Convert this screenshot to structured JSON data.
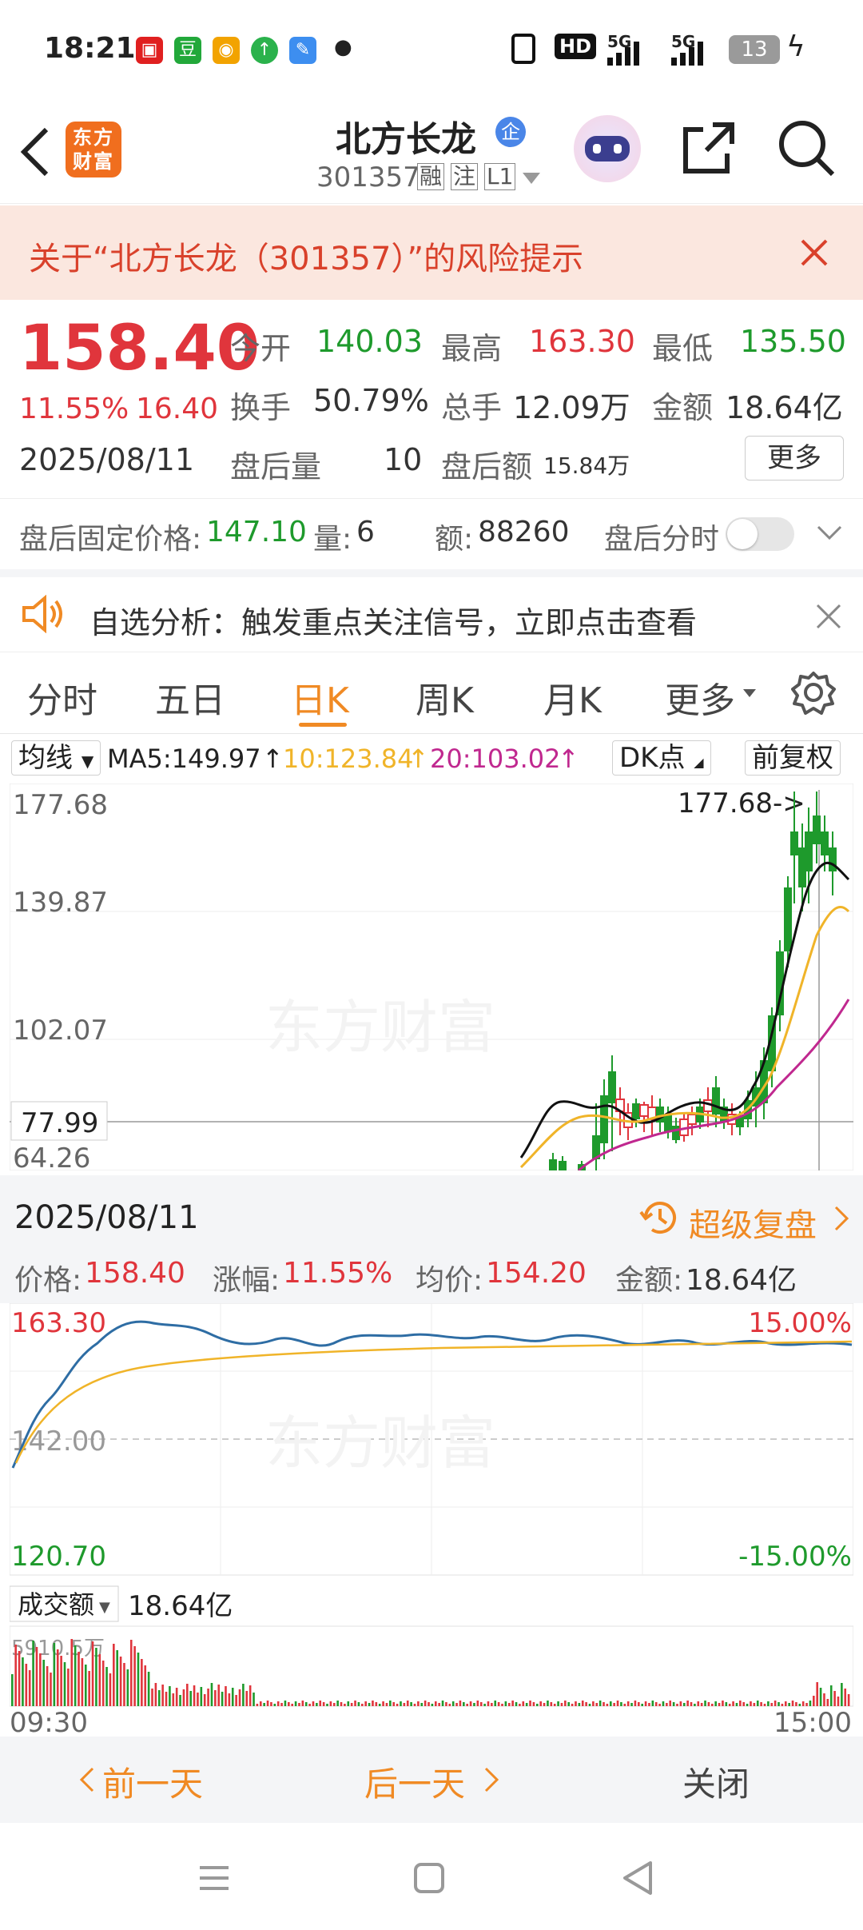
{
  "status_bar": {
    "time": "18:21",
    "battery": "13",
    "net1": "5G",
    "net2": "5G",
    "hd": "HD"
  },
  "header": {
    "logo_text": "东方财富",
    "stock_name": "北方长龙",
    "badge": "企",
    "code": "301357",
    "tags": [
      "融",
      "注",
      "L1"
    ]
  },
  "risk_banner": {
    "text": "关于“北方长龙（301357）”的风险提示"
  },
  "quote": {
    "price": "158.40",
    "change_pct": "11.55%",
    "change": "16.40",
    "date": "2025/08/11",
    "open_label": "今开",
    "open": "140.03",
    "high_label": "最高",
    "high": "163.30",
    "low_label": "最低",
    "low": "135.50",
    "turnover_label": "换手",
    "turnover": "50.79%",
    "volume_label": "总手",
    "volume": "12.09万",
    "amount_label": "金额",
    "amount": "18.64亿",
    "ah_vol_label": "盘后量",
    "ah_vol": "10",
    "ah_amt_label": "盘后额",
    "ah_amt": "15.84万",
    "more_button": "更多"
  },
  "after_hours": {
    "price_label": "盘后固定价格:",
    "price": "147.10",
    "qty_label": "量:",
    "qty": "6",
    "amt_label": "额:",
    "amt": "88260",
    "toggle_label": "盘后分时"
  },
  "analysis_banner": {
    "text": "自选分析：触发重点关注信号，立即点击查看"
  },
  "tabs": [
    "分时",
    "五日",
    "日K",
    "周K",
    "月K",
    "更多"
  ],
  "active_tab": "日K",
  "kline": {
    "indicator_select": "均线",
    "ma5": "MA5:149.97",
    "ma10": "10:123.84",
    "ma20": "20:103.02",
    "dk_button": "DK点",
    "adjust_button": "前复权",
    "y_labels": [
      "177.68",
      "139.87",
      "102.07",
      "77.99",
      "64.26"
    ],
    "max_marker": "177.68->"
  },
  "intraday": {
    "date": "2025/08/11",
    "replay_button": "超级复盘",
    "price_label": "价格:",
    "price": "158.40",
    "pct_label": "涨幅:",
    "pct": "11.55%",
    "avg_label": "均价:",
    "avg": "154.20",
    "amount_label": "金额:",
    "amount": "18.64亿",
    "top_price": "163.30",
    "mid_price": "142.00",
    "bottom_price": "120.70",
    "top_pct": "15.00%",
    "bottom_pct": "-15.00%",
    "vol_select": "成交额",
    "vol_total": "18.64亿",
    "vol_scale": "5910.5万",
    "time_start": "09:30",
    "time_end": "15:00"
  },
  "bottom_nav": {
    "prev": "前一天",
    "next": "后一天",
    "close": "关闭"
  },
  "colors": {
    "red": "#e0353c",
    "green": "#1e9a2c",
    "orange": "#f08a24",
    "ma10": "#f0b429",
    "ma20": "#c0288f",
    "line": "#2e6da4"
  }
}
